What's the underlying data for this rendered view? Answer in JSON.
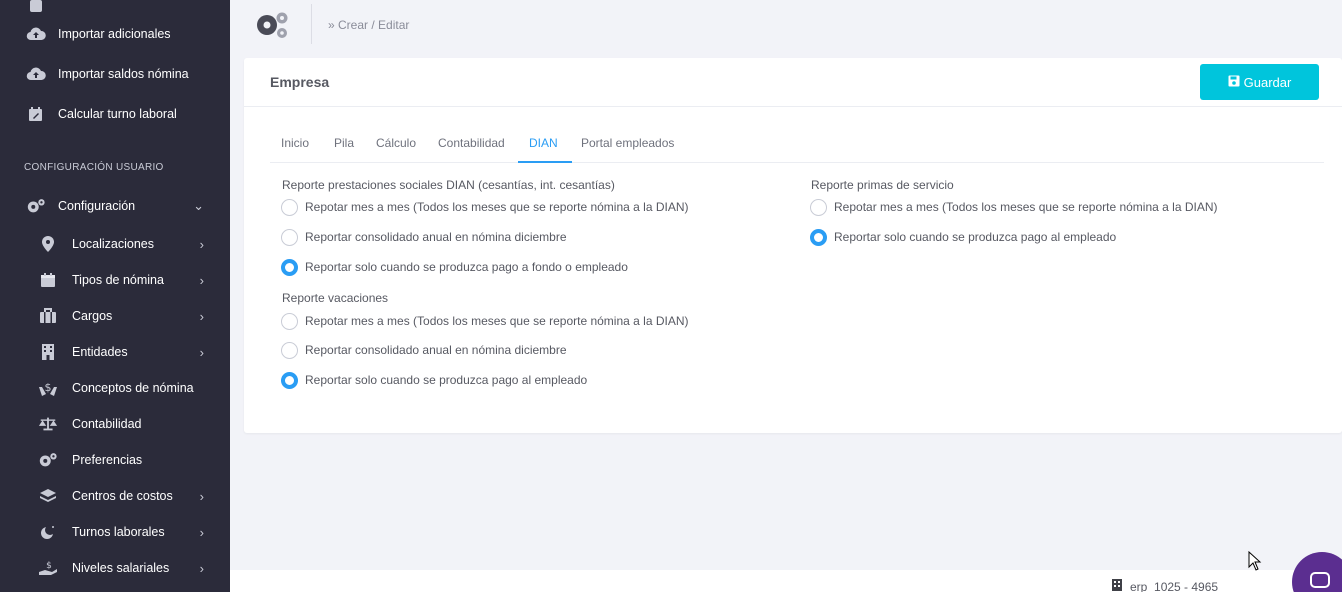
{
  "sidebar": {
    "top_items": [
      {
        "label": "Importar adicionales",
        "icon": "cloud-upload-icon"
      },
      {
        "label": "Importar saldos nómina",
        "icon": "cloud-upload-icon"
      },
      {
        "label": "Calcular turno laboral",
        "icon": "calendar-edit-icon"
      }
    ],
    "section_title": "CONFIGURACIÓN USUARIO",
    "config": {
      "label": "Configuración",
      "icon": "gears-icon",
      "chevron": "⌄"
    },
    "sub_items": [
      {
        "label": "Localizaciones",
        "icon": "map-pin-icon",
        "chevron": "›"
      },
      {
        "label": "Tipos de nómina",
        "icon": "calendar-icon",
        "chevron": "›"
      },
      {
        "label": "Cargos",
        "icon": "briefcase-icon",
        "chevron": "›"
      },
      {
        "label": "Entidades",
        "icon": "building-icon",
        "chevron": "›"
      },
      {
        "label": "Conceptos de nómina",
        "icon": "hand-dollar-icon",
        "chevron": ""
      },
      {
        "label": "Contabilidad",
        "icon": "balance-scale-icon",
        "chevron": ""
      },
      {
        "label": "Preferencias",
        "icon": "gear-icon",
        "chevron": ""
      },
      {
        "label": "Centros de costos",
        "icon": "layers-icon",
        "chevron": "›"
      },
      {
        "label": "Turnos laborales",
        "icon": "moon-icon",
        "chevron": "›"
      },
      {
        "label": "Niveles salariales",
        "icon": "hand-money-icon",
        "chevron": "›"
      }
    ]
  },
  "header": {
    "breadcrumb": "» Crear / Editar",
    "icon": "gears-icon"
  },
  "card": {
    "title": "Empresa",
    "save_label": "Guardar",
    "save_icon": "floppy-disk-icon",
    "accent": "#00c5dc"
  },
  "tabs": [
    {
      "label": "Inicio",
      "active": false
    },
    {
      "label": "Pila",
      "active": false
    },
    {
      "label": "Cálculo",
      "active": false
    },
    {
      "label": "Contabilidad",
      "active": false
    },
    {
      "label": "DIAN",
      "active": true
    },
    {
      "label": "Portal empleados",
      "active": false
    }
  ],
  "dian": {
    "prestaciones": {
      "label": "Reporte prestaciones sociales DIAN (cesantías, int. cesantías)",
      "options": [
        {
          "label": "Repotar mes a mes (Todos los meses que se reporte nómina a la DIAN)",
          "checked": false
        },
        {
          "label": "Reportar consolidado anual en nómina diciembre",
          "checked": false
        },
        {
          "label": "Reportar solo cuando se produzca pago a fondo o empleado",
          "checked": true
        }
      ]
    },
    "vacaciones": {
      "label": "Reporte vacaciones",
      "options": [
        {
          "label": "Repotar mes a mes (Todos los meses que se reporte nómina a la DIAN)",
          "checked": false
        },
        {
          "label": "Reportar consolidado anual en nómina diciembre",
          "checked": false
        },
        {
          "label": "Reportar solo cuando se produzca pago al empleado",
          "checked": true
        }
      ]
    },
    "primas": {
      "label": "Reporte primas de servicio",
      "options": [
        {
          "label": "Repotar mes a mes (Todos los meses que se reporte nómina a la DIAN)",
          "checked": false
        },
        {
          "label": "Reportar solo cuando se produzca pago al empleado",
          "checked": true
        }
      ]
    }
  },
  "footer": {
    "text": "erp_1025 - 4965",
    "icon": "building-icon"
  },
  "chat": {
    "icon": "chat-icon",
    "color": "#5b2e90"
  }
}
